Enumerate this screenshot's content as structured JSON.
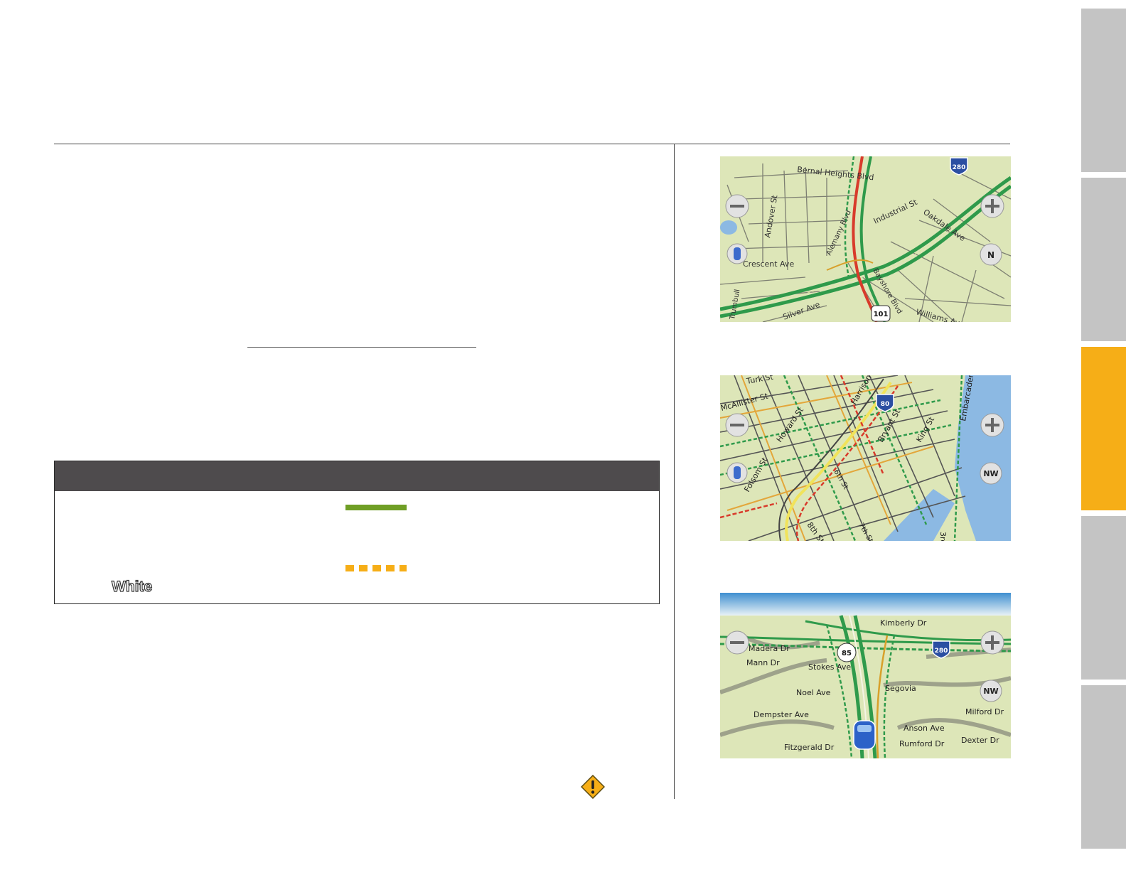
{
  "legend": {
    "white_label": "White",
    "swatch_colors": {
      "solid": "#6f9e25",
      "dashed": "#f6ae17"
    }
  },
  "side_tabs": [
    {
      "active": false
    },
    {
      "active": false
    },
    {
      "active": true
    },
    {
      "active": false
    },
    {
      "active": false
    }
  ],
  "maps": [
    {
      "compass": "N",
      "labels": {
        "l1": "Bernal Heights Blvd",
        "l2": "Andover St",
        "l3": "Industrial St",
        "l4": "Oakdale Ave",
        "l5": "Alemany Blvd",
        "l6": "Crescent Ave",
        "l7": "Silver Ave",
        "l8": "Bayshore Blvd",
        "l9": "Williams Ave",
        "l10": "Trumbull"
      },
      "shields": {
        "interstate": "280",
        "us_route": "101"
      }
    },
    {
      "compass": "NW",
      "labels": {
        "l1": "Turk St",
        "l2": "McAllister St",
        "l3": "Harrison St",
        "l4": "Howard St",
        "l5": "Bryant St",
        "l6": "Folsom St",
        "l7": "6th St",
        "l8": "8th St",
        "l9": "King St",
        "l10": "Embarcadero",
        "l11": "3rd St",
        "l12": "7th St"
      },
      "shields": {
        "interstate": "80"
      }
    },
    {
      "compass": "NW",
      "labels": {
        "l1": "Kimberly Dr",
        "l2": "Madera Dr",
        "l3": "Mann Dr",
        "l4": "Stokes Ave",
        "l5": "Segovia",
        "l6": "Noel Ave",
        "l7": "Milford Dr",
        "l8": "Dempster Ave",
        "l9": "Anson Ave",
        "l10": "Dexter Dr",
        "l11": "Fitzgerald Dr",
        "l12": "Rumford Dr"
      },
      "shields": {
        "state_route": "85",
        "interstate": "280"
      }
    }
  ]
}
